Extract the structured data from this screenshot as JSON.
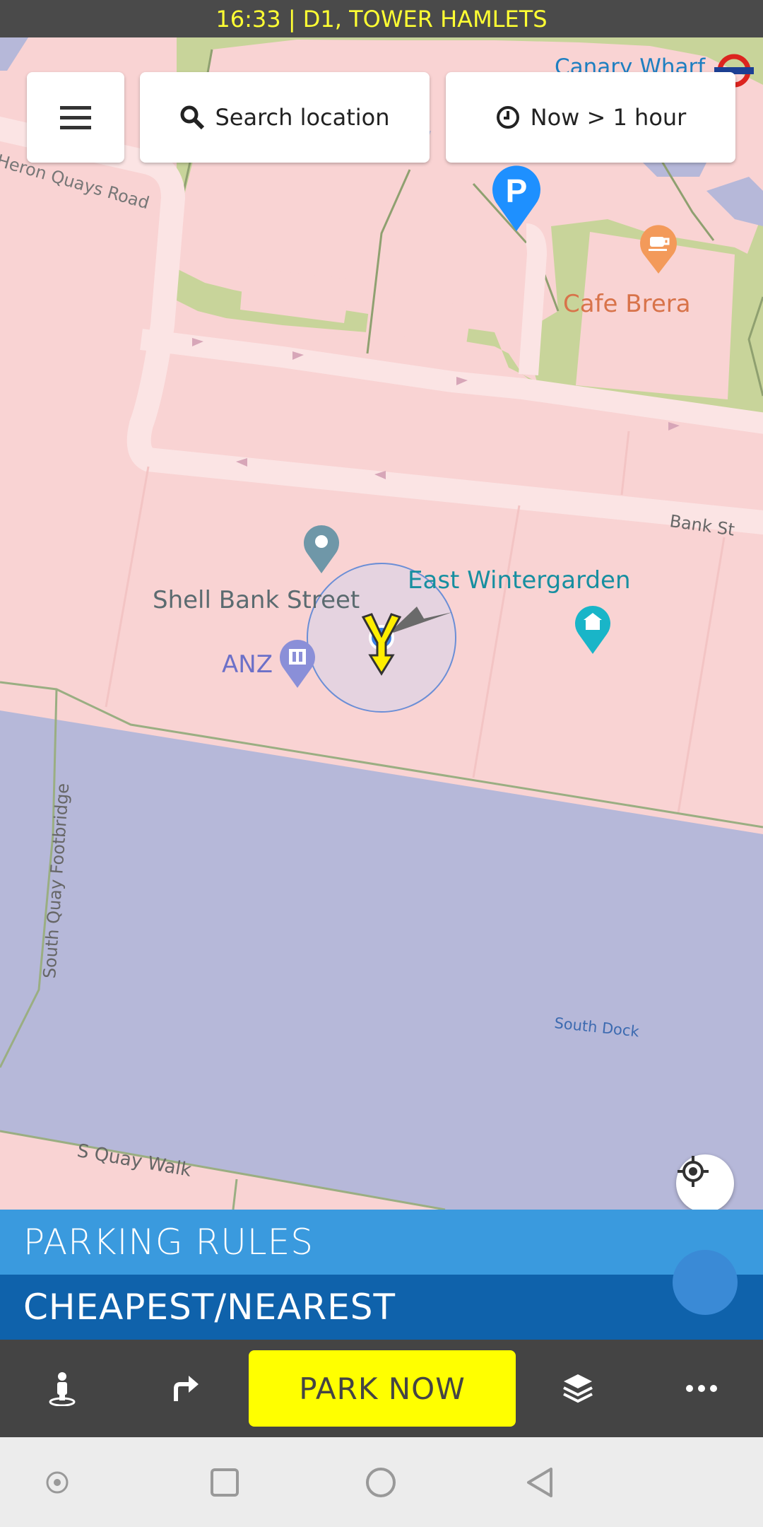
{
  "status_bar": {
    "text": "16:33 | D1, TOWER HAMLETS"
  },
  "header": {
    "menu_icon": "hamburger-menu-icon",
    "search": {
      "icon": "search-icon",
      "label": "Search location"
    },
    "time": {
      "icon": "clock-icon",
      "label": "Now > 1 hour"
    }
  },
  "map": {
    "labels": {
      "canary_wharf": "Canary Wharf",
      "heron_quays_road": "Heron Quays Road",
      "cafe_brera": "Cafe Brera",
      "bank_st": "Bank St",
      "shell_bank_street": "Shell Bank Street",
      "east_wintergarden": "East Wintergarden",
      "anz": "ANZ",
      "south_quay_footbridge": "South Quay Footbridge",
      "south_dock": "South Dock",
      "s_quay_walk": "S Quay Walk"
    },
    "parking_marker": "P",
    "colors": {
      "land": "#f9d3d3",
      "park": "#c8d49a",
      "water": "#b6b8d9",
      "road": "#fbdede",
      "accent": "#1e90ff"
    }
  },
  "panels": {
    "parking_rules": "PARKING RULES",
    "cheapest_nearest": "CHEAPEST/NEAREST"
  },
  "toolbar": {
    "park_now": "PARK NOW",
    "icons": [
      "person-icon",
      "turn-right-icon",
      "layers-icon",
      "more-icon"
    ]
  },
  "navbar": {
    "icons": [
      "recent-apps-dot-icon",
      "overview-square-icon",
      "home-circle-icon",
      "back-triangle-icon"
    ]
  }
}
